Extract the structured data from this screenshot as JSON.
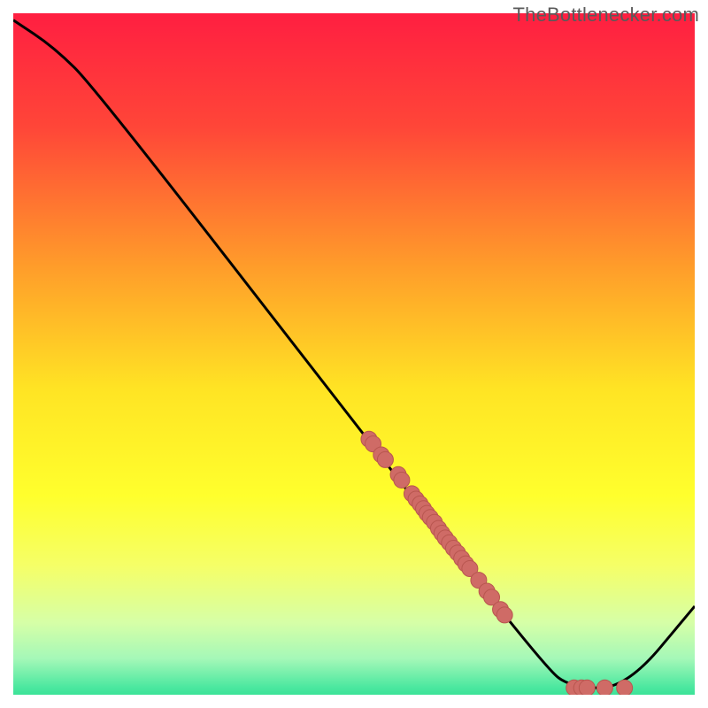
{
  "watermark": "TheBottlenecker.com",
  "chart_data": {
    "type": "line",
    "title": "",
    "xlabel": "",
    "ylabel": "",
    "xlim": [
      0,
      100
    ],
    "ylim": [
      0,
      100
    ],
    "curve": [
      {
        "x": 0,
        "y": 99
      },
      {
        "x": 6,
        "y": 95
      },
      {
        "x": 12,
        "y": 89
      },
      {
        "x": 50,
        "y": 40
      },
      {
        "x": 78,
        "y": 4
      },
      {
        "x": 82,
        "y": 1
      },
      {
        "x": 90,
        "y": 1
      },
      {
        "x": 100,
        "y": 13
      }
    ],
    "scatter_points": [
      {
        "x": 52.2,
        "y": 37.5
      },
      {
        "x": 52.8,
        "y": 36.8
      },
      {
        "x": 54.0,
        "y": 35.2
      },
      {
        "x": 54.6,
        "y": 34.5
      },
      {
        "x": 56.5,
        "y": 32.3
      },
      {
        "x": 57.0,
        "y": 31.5
      },
      {
        "x": 58.5,
        "y": 29.5
      },
      {
        "x": 59.1,
        "y": 28.7
      },
      {
        "x": 59.7,
        "y": 28.0
      },
      {
        "x": 60.2,
        "y": 27.3
      },
      {
        "x": 60.7,
        "y": 26.6
      },
      {
        "x": 61.2,
        "y": 26.0
      },
      {
        "x": 61.8,
        "y": 25.3
      },
      {
        "x": 62.4,
        "y": 24.4
      },
      {
        "x": 62.9,
        "y": 23.7
      },
      {
        "x": 63.4,
        "y": 23.0
      },
      {
        "x": 64.0,
        "y": 22.3
      },
      {
        "x": 64.6,
        "y": 21.5
      },
      {
        "x": 65.2,
        "y": 20.8
      },
      {
        "x": 65.8,
        "y": 20.0
      },
      {
        "x": 66.4,
        "y": 19.2
      },
      {
        "x": 67.0,
        "y": 18.5
      },
      {
        "x": 68.3,
        "y": 16.8
      },
      {
        "x": 69.5,
        "y": 15.2
      },
      {
        "x": 70.2,
        "y": 14.3
      },
      {
        "x": 71.5,
        "y": 12.5
      },
      {
        "x": 72.1,
        "y": 11.7
      },
      {
        "x": 82.3,
        "y": 1.0
      },
      {
        "x": 83.4,
        "y": 1.0
      },
      {
        "x": 84.2,
        "y": 1.0
      },
      {
        "x": 86.8,
        "y": 1.0
      },
      {
        "x": 89.7,
        "y": 1.0
      }
    ],
    "gradient_stops": [
      {
        "offset": 0.0,
        "color": "#ff1a42"
      },
      {
        "offset": 0.18,
        "color": "#ff4638"
      },
      {
        "offset": 0.38,
        "color": "#ff9e2a"
      },
      {
        "offset": 0.55,
        "color": "#ffe424"
      },
      {
        "offset": 0.7,
        "color": "#ffff2d"
      },
      {
        "offset": 0.8,
        "color": "#f5ff68"
      },
      {
        "offset": 0.88,
        "color": "#d6ffa7"
      },
      {
        "offset": 0.93,
        "color": "#a5f8b8"
      },
      {
        "offset": 0.97,
        "color": "#4de8a0"
      },
      {
        "offset": 1.0,
        "color": "#1fd98b"
      }
    ],
    "line_color": "#000000",
    "point_fill": "#cf6b66",
    "point_stroke": "#b8564f",
    "frame_color": "#ffffff",
    "frame_width": 15
  }
}
